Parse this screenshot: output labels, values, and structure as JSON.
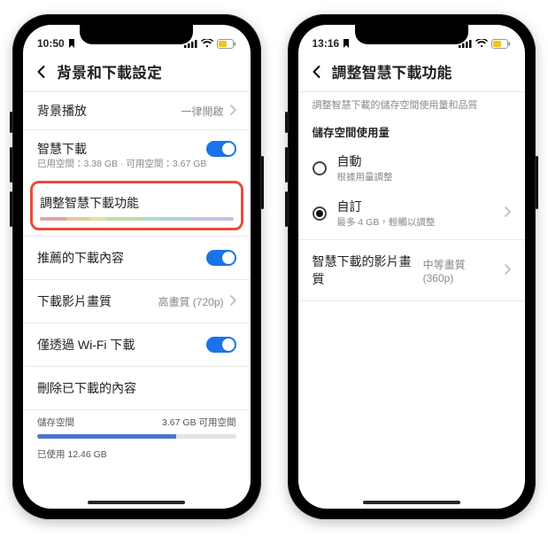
{
  "left": {
    "status": {
      "time": "10:50"
    },
    "header": {
      "title": "背景和下載設定"
    },
    "rows": {
      "bg_play": {
        "label": "背景播放",
        "value": "一律開啟"
      },
      "smart_dl": {
        "label": "智慧下載",
        "sub": "已用空間：3.38 GB · 可用空間：3.67 GB"
      },
      "adjust": {
        "label": "調整智慧下載功能"
      },
      "recommended": {
        "label": "推薦的下載內容"
      },
      "quality": {
        "label": "下載影片畫質",
        "value": "高畫質 (720p)"
      },
      "wifi": {
        "label": "僅透過 Wi-Fi 下載"
      },
      "delete": {
        "label": "刪除已下載的內容"
      }
    },
    "storage": {
      "left_label": "儲存空間",
      "right_label": "3.67 GB 可用空間",
      "used_label": "已使用 12.46 GB",
      "used_pct": 70
    }
  },
  "right": {
    "status": {
      "time": "13:16"
    },
    "header": {
      "title": "調整智慧下載功能"
    },
    "desc": "調整智慧下載的儲存空間使用量和品質",
    "section_storage": "儲存空間使用量",
    "options": {
      "auto": {
        "title": "自動",
        "sub": "根據用量調整"
      },
      "custom": {
        "title": "自訂",
        "sub": "最多 4 GB，輕觸以調整"
      }
    },
    "quality": {
      "label": "智慧下載的影片畫質",
      "value": "中等畫質 (360p)"
    }
  }
}
